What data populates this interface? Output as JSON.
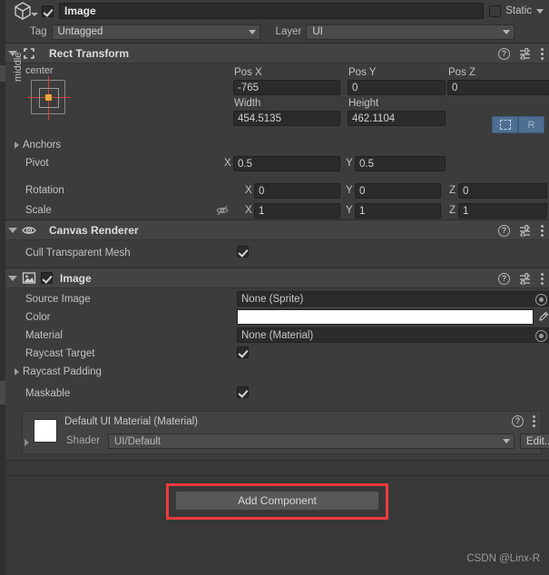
{
  "gameobject": {
    "icon": "cube-icon",
    "enabled": true,
    "name": "Image",
    "static_label": "Static",
    "static_checked": false,
    "tag_label": "Tag",
    "tag_value": "Untagged",
    "layer_label": "Layer",
    "layer_value": "UI"
  },
  "components": [
    {
      "id": "rect-transform",
      "title": "Rect Transform",
      "icon": "rect-transform-icon",
      "expanded": true,
      "anchor_preset": {
        "horizontal": "center",
        "vertical": "middle"
      },
      "fields": {
        "pos_x_label": "Pos X",
        "pos_x": "-765",
        "pos_y_label": "Pos Y",
        "pos_y": "0",
        "pos_z_label": "Pos Z",
        "pos_z": "0",
        "width_label": "Width",
        "width": "454.5135",
        "height_label": "Height",
        "height": "462.1104",
        "anchors_label": "Anchors",
        "pivot_label": "Pivot",
        "pivot_x": "0.5",
        "pivot_y": "0.5",
        "rotation_label": "Rotation",
        "rotation_x": "0",
        "rotation_y": "0",
        "rotation_z": "0",
        "scale_label": "Scale",
        "scale_x": "1",
        "scale_y": "1",
        "scale_z": "1",
        "axis_x": "X",
        "axis_y": "Y",
        "axis_z": "Z",
        "blueprint_button": "blueprint-mode-icon",
        "rawedit_button": "R"
      }
    },
    {
      "id": "canvas-renderer",
      "title": "Canvas Renderer",
      "icon": "eye-icon",
      "expanded": true,
      "fields": {
        "cull_label": "Cull Transparent Mesh",
        "cull_checked": true
      }
    },
    {
      "id": "image",
      "title": "Image",
      "icon": "image-icon",
      "expanded": true,
      "enabled": true,
      "fields": {
        "source_image_label": "Source Image",
        "source_image_value": "None (Sprite)",
        "color_label": "Color",
        "color_value": "#FFFFFF",
        "material_label": "Material",
        "material_value": "None (Material)",
        "raycast_target_label": "Raycast Target",
        "raycast_target_checked": true,
        "raycast_padding_label": "Raycast Padding",
        "maskable_label": "Maskable",
        "maskable_checked": true
      }
    }
  ],
  "material_inspector": {
    "title": "Default UI Material (Material)",
    "swatch_color": "#FFFFFF",
    "shader_label": "Shader",
    "shader_value": "UI/Default",
    "edit_label": "Edit..."
  },
  "add_component": {
    "label": "Add Component",
    "highlight_color": "#F0393C"
  },
  "watermark": "CSDN @Linx-R"
}
